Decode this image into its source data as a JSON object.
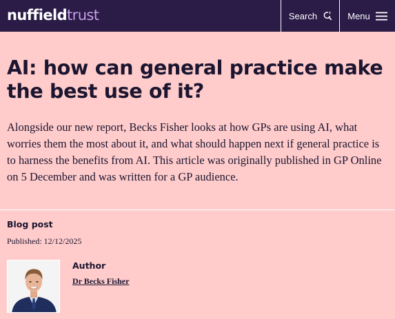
{
  "header": {
    "logo": {
      "part1": "nuffield",
      "part2": "trust"
    },
    "search_label": "Search",
    "menu_label": "Menu"
  },
  "article": {
    "title": "AI: how can general practice make the best use of it?",
    "intro": "Alongside our new report, Becks Fisher looks at how GPs are using AI, what worries them the most about it, and what should happen next if general practice is to harness the benefits from AI. This article was originally published in GP Online on 5 December and was written for a GP audience.",
    "post_type": "Blog post",
    "published": "Published: 12/12/2025",
    "author_heading": "Author",
    "author_name": "Dr Becks Fisher"
  },
  "colors": {
    "header_bg": "#2a1b47",
    "page_bg": "#ffcccb",
    "logo_accent": "#c7a0e6",
    "text": "#1b1530"
  },
  "icons": [
    "search-icon",
    "hamburger-menu-icon"
  ]
}
